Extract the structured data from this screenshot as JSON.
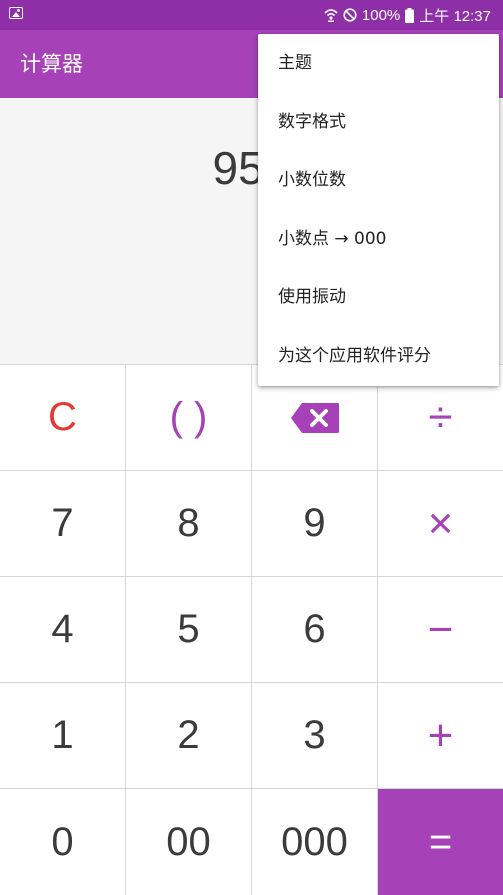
{
  "status_bar": {
    "battery_text": "100%",
    "time_text": "上午 12:37",
    "icons": [
      "image-notification-icon",
      "wifi-calling-icon",
      "do-not-disturb-icon",
      "battery-icon"
    ]
  },
  "app_bar": {
    "title": "计算器"
  },
  "display": {
    "expression": "95×"
  },
  "keypad": {
    "rows": [
      [
        {
          "label": "C"
        },
        {
          "label": "( )"
        },
        {
          "label": "",
          "icon": "backspace-icon"
        },
        {
          "label": "÷"
        }
      ],
      [
        {
          "label": "7"
        },
        {
          "label": "8"
        },
        {
          "label": "9"
        },
        {
          "label": "×"
        }
      ],
      [
        {
          "label": "4"
        },
        {
          "label": "5"
        },
        {
          "label": "6"
        },
        {
          "label": "−"
        }
      ],
      [
        {
          "label": "1"
        },
        {
          "label": "2"
        },
        {
          "label": "3"
        },
        {
          "label": "+"
        }
      ],
      [
        {
          "label": "0"
        },
        {
          "label": "00"
        },
        {
          "label": "000"
        },
        {
          "label": "="
        }
      ]
    ]
  },
  "menu": {
    "items": [
      {
        "label": "主题"
      },
      {
        "label": "数字格式"
      },
      {
        "label": "小数位数"
      },
      {
        "label": "小数点 → 000"
      },
      {
        "label": "使用振动"
      },
      {
        "label": "为这个应用软件评分"
      }
    ]
  },
  "colors": {
    "status_bar": "#8e2fa8",
    "accent": "#a641b8",
    "clear_key": "#e53935",
    "display_background": "#f5f5f6",
    "text": "#3b3b3b"
  }
}
